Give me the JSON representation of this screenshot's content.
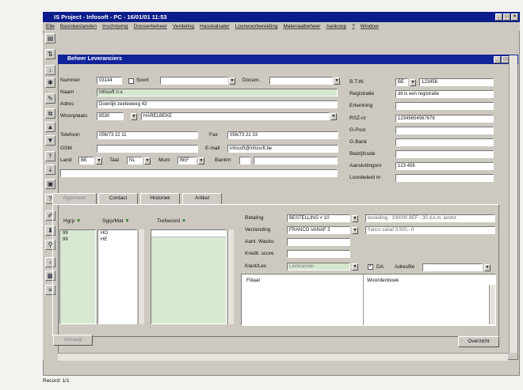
{
  "app": {
    "title": "IS Project - Infosoft - PC - 16/01/01 11:53",
    "menu": [
      "Elle",
      "Basisbestanden",
      "Inschrijving",
      "Dossierbeheer",
      "Verdeling",
      "Haoskalsaler",
      "Loonvoorbereiding",
      "Materiaalbeheer",
      "Aankoop",
      "?",
      "Window"
    ]
  },
  "child": {
    "title": "Beheer Leveranciers"
  },
  "form": {
    "nummer_label": "Nummer",
    "nummer_value": "03144",
    "soort_label": "Soort",
    "soort_value": "",
    "docum_label": "Docum.",
    "docum_value": "",
    "naam_label": "Naam",
    "naam_value": "Infosoft n.v.",
    "adres_label": "Adres",
    "adres_value": "Doenlijk zeeteeweg 43",
    "woonplaats_label": "Woonplaats",
    "postcode_value": "8530",
    "gemeente_value": "HARELBEKE",
    "telefoon_label": "Telefoon",
    "telefoon_value": "056/73 22 11",
    "fax_label": "Fax",
    "fax_value": "056/73 22 33",
    "gsm_label": "GSM",
    "gsm_value": "",
    "email_label": "E-mail",
    "email_value": "infosoft@infosoft.be",
    "land_label": "Land",
    "land_value": "BE",
    "taal_label": "Taal",
    "taal_value": "NL",
    "munt_label": "Munt",
    "munt_value": "BEF",
    "bankrn_label": "Bankrn",
    "bankrn_value": "",
    "btw_label": "B.T.W.",
    "btw_country": "BE",
    "btw_value": "123456",
    "registratie_label": "Registratie",
    "registratie_value": "dit is een registratie",
    "erkenning_label": "Erkenning",
    "erkenning_value": "",
    "rsz_label": "RSZ-nr",
    "rsz_value": "12345654567678",
    "gpost_label": "G-Post",
    "gpost_value": "",
    "gbank_label": "G-Bank",
    "gbank_value": "",
    "bedrijfcode_label": "Bedrijfcode",
    "bedrijfcode_value": "",
    "aansluiting_label": "Aansluitingsnr",
    "aansluiting_value": "123 456",
    "loonbeleid_label": "Loonbeleid nr",
    "loonbeleid_value": ""
  },
  "tabs": [
    "Algemeen",
    "Contact",
    "Historiek",
    "Artikel"
  ],
  "grid": {
    "col1": "Hgrp",
    "col2": "Sgrp/Mat",
    "col3": "Trefwoord",
    "rows": [
      {
        "hgrp": "99",
        "sgrp": "HO",
        "trefwoord": ""
      },
      {
        "hgrp": "99",
        "sgrp": "HE",
        "trefwoord": ""
      }
    ]
  },
  "lower": {
    "betaling_label": "Betaling",
    "betaling_value": "BESTELLING < 10",
    "betaling_desc": "bestelling : 100000 BEF - 30 d.e.m. landst",
    "verzending_label": "Verzending",
    "verzending_value": "FRANCO VANAF 3",
    "verzending_desc": "franco vanaf 3.500,- fr",
    "aant_wacko_label": "Aant. Wacko",
    "aant_wacko_value": "",
    "kredit_label": "Kredit. score",
    "kredit_value": "",
    "klantlev_label": "Klant/Lev",
    "klantlev_value": "Leverancier",
    "da_label": "DA",
    "da_checked": "✓",
    "adresfile_label": "Adresfile",
    "adresfile_value": "",
    "filiaal_label": "Filiaal",
    "woordenboek_label": "Woordenboek"
  },
  "buttons": {
    "left": "Verlaagl",
    "right": "Overzicht"
  },
  "status": {
    "text": "Record: 1/1"
  },
  "toolbar_icons": [
    "open-icon",
    "sort-icon",
    "sort-asc-icon",
    "filter-icon",
    "tools-icon",
    "copy-icon",
    "arrow-up-icon",
    "arrow-down-icon",
    "first-record-icon",
    "last-record-icon",
    "print-icon",
    "help-icon",
    "edit-icon",
    "move-down-icon",
    "locate-icon",
    "next-icon",
    "calc-icon",
    "close-icon"
  ],
  "colors": {
    "titlebar": "#0b1d8a",
    "field_green": "#d7e6cf",
    "window": "#cdc9c1"
  }
}
